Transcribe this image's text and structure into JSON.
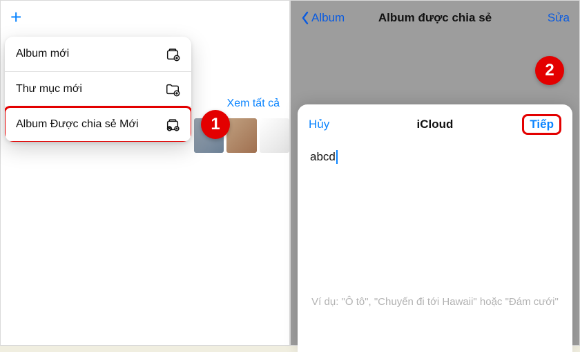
{
  "left": {
    "plus": "+",
    "menu": {
      "items": [
        {
          "label": "Album mới"
        },
        {
          "label": "Thư mục mới"
        },
        {
          "label": "Album Được chia sẻ Mới"
        }
      ]
    },
    "see_all": "Xem tất cả",
    "badge": "1"
  },
  "right": {
    "nav": {
      "back": "Album",
      "title": "Album được chia sẻ",
      "edit": "Sửa"
    },
    "badge": "2",
    "sheet": {
      "cancel": "Hủy",
      "title": "iCloud",
      "next": "Tiếp",
      "input_value": "abcd",
      "hint": "Ví dụ: \"Ô tô\", \"Chuyến đi tới Hawaii\" hoặc \"Đám cưới\""
    }
  }
}
